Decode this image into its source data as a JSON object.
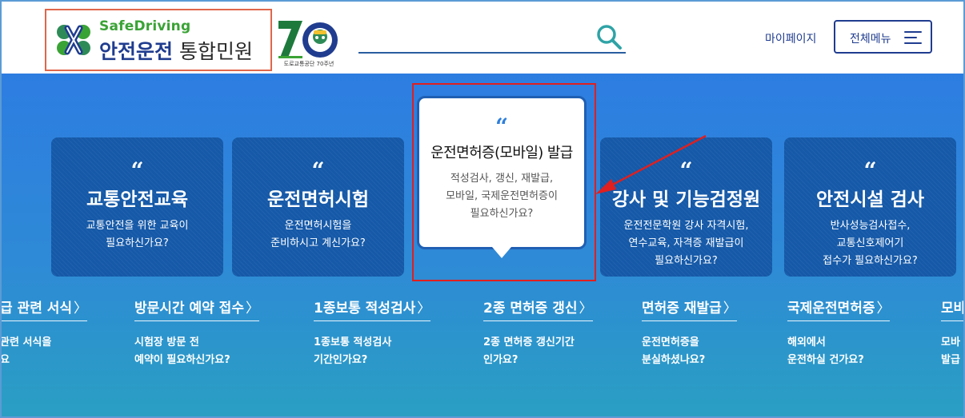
{
  "header": {
    "logo_en": "SafeDriving",
    "logo_ko_main": "안전운전",
    "logo_ko_sub": "통합민원",
    "anniversary_text": "도로교통공단 70주년",
    "anniversary_number": "70",
    "mypage_label": "마이페이지",
    "menu_label": "전체메뉴",
    "search_value": ""
  },
  "cards": [
    {
      "quote": "“",
      "title": "교통안전교육",
      "desc": [
        "교통안전을 위한 교육이",
        "필요하신가요?"
      ]
    },
    {
      "quote": "“",
      "title": "운전면허시험",
      "desc": [
        "운전면허시험을",
        "준비하시고 계신가요?"
      ]
    },
    {
      "quote": "“",
      "title": "운전면허증(모바일) 발급",
      "desc": [
        "적성검사, 갱신, 재발급,",
        "모바일, 국제운전면허증이",
        "필요하신가요?"
      ]
    },
    {
      "quote": "“",
      "title": "강사 및 기능검정원",
      "desc": [
        "운전전문학원 강사 자격시험,",
        "연수교육, 자격증 재발급이",
        "필요하신가요?"
      ]
    },
    {
      "quote": "“",
      "title": "안전시설 검사",
      "desc": [
        "반사성능검사접수,",
        "교통신호제어기",
        "접수가 필요하신가요?"
      ]
    }
  ],
  "links": [
    {
      "title": "급 관련 서식",
      "chev": "〉",
      "desc": [
        "관련 서식을",
        "요"
      ]
    },
    {
      "title": "방문시간 예약 접수",
      "chev": "〉",
      "desc": [
        "시험장 방문 전",
        "예약이 필요하신가요?"
      ]
    },
    {
      "title": "1종보통 적성검사",
      "chev": "〉",
      "desc": [
        "1종보통 적성검사",
        "기간인가요?"
      ]
    },
    {
      "title": "2종 면허증 갱신",
      "chev": "〉",
      "desc": [
        "2종 면허증 갱신기간",
        "인가요?"
      ]
    },
    {
      "title": "면허증 재발급",
      "chev": "〉",
      "desc": [
        "운전면허증을",
        "분실하셨나요?"
      ]
    },
    {
      "title": "국제운전면허증",
      "chev": "〉",
      "desc": [
        "해외에서",
        "운전하실 건가요?"
      ]
    },
    {
      "title": "모바",
      "chev": "",
      "desc": [
        "모바",
        "발급"
      ]
    }
  ],
  "colors": {
    "brand_navy": "#1f3c8f",
    "brand_green": "#3aa335",
    "card_bg": "#1559a8",
    "highlight_red": "#e01f1f"
  }
}
